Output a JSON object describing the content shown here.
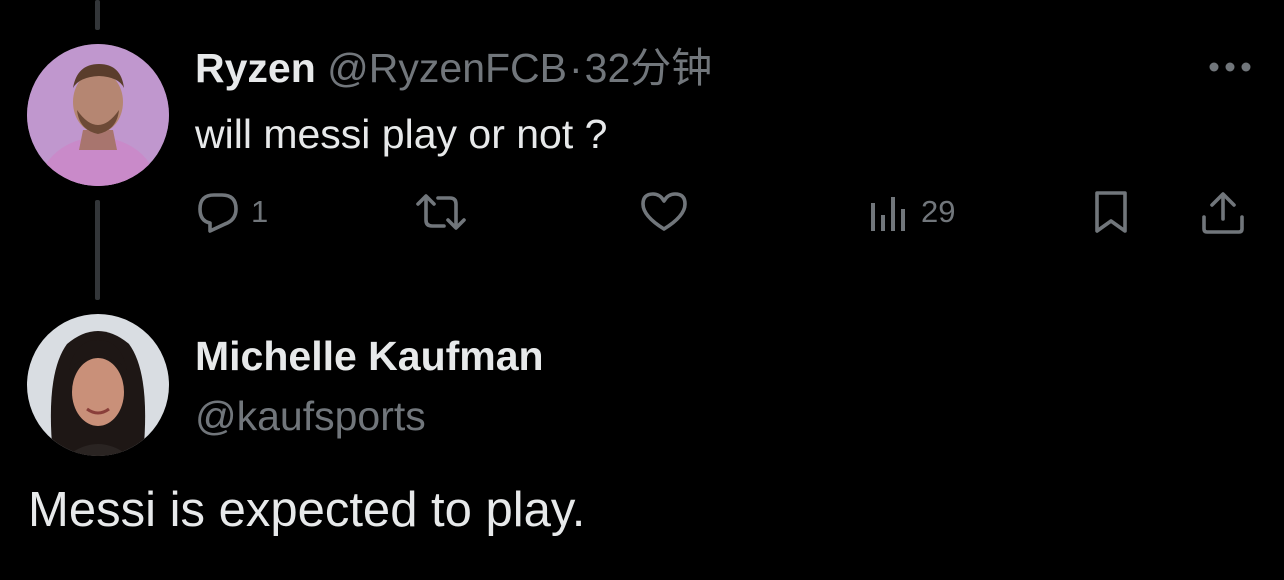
{
  "colors": {
    "background": "#000000",
    "primary_text": "#e7e9ea",
    "secondary_text": "#71767b",
    "thread_line": "#333639"
  },
  "reply_tweet": {
    "author_name": "Ryzen",
    "author_handle": "@RyzenFCB",
    "separator": "·",
    "time": "32分钟",
    "text": "will messi play or not ?",
    "more_icon": "more-dots-icon",
    "actions": {
      "reply": {
        "icon": "reply-icon",
        "count": "1"
      },
      "retweet": {
        "icon": "retweet-icon",
        "count": ""
      },
      "like": {
        "icon": "heart-icon",
        "count": ""
      },
      "views": {
        "icon": "views-bar-icon",
        "count": "29"
      },
      "bookmark": {
        "icon": "bookmark-icon"
      },
      "share": {
        "icon": "share-icon"
      }
    }
  },
  "quoted_reply": {
    "author_name": "Michelle Kaufman",
    "author_handle": "@kaufsports",
    "text": "Messi is expected to play."
  }
}
